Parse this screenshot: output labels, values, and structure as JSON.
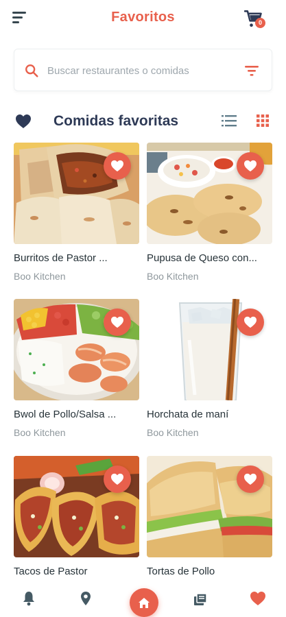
{
  "header": {
    "title": "Favoritos",
    "menu_icon": "menu-icon",
    "cart_icon": "cart-icon",
    "cart_count": "0"
  },
  "search": {
    "placeholder": "Buscar restaurantes o comidas",
    "value": "",
    "search_icon": "search-icon",
    "filter_icon": "filter-icon"
  },
  "section": {
    "title": "Comidas favoritas",
    "heart_icon": "heart-icon",
    "list_view_icon": "list-view-icon",
    "grid_view_icon": "grid-view-icon",
    "active_view": "grid"
  },
  "foods": [
    {
      "name": "Burritos de Pastor ...",
      "restaurant": "Boo Kitchen",
      "favorite": true,
      "image": "burritos"
    },
    {
      "name": "Pupusa de Queso con...",
      "restaurant": "Boo Kitchen",
      "favorite": true,
      "image": "pupusa"
    },
    {
      "name": "Bwol de Pollo/Salsa ...",
      "restaurant": "Boo Kitchen",
      "favorite": true,
      "image": "bowl"
    },
    {
      "name": "Horchata de maní",
      "restaurant": "Boo Kitchen",
      "favorite": true,
      "image": "horchata"
    },
    {
      "name": "Tacos de Pastor",
      "restaurant": "",
      "favorite": true,
      "image": "tacos"
    },
    {
      "name": "Tortas de Pollo",
      "restaurant": "",
      "favorite": true,
      "image": "tortas"
    }
  ],
  "bottom_nav": {
    "items": [
      "notifications-icon",
      "location-icon",
      "home-icon",
      "menu-book-icon",
      "favorites-icon"
    ],
    "active": "favorites-icon"
  },
  "colors": {
    "accent": "#e8604c",
    "title_text": "#2e3a56",
    "secondary_text": "#8e979c"
  }
}
